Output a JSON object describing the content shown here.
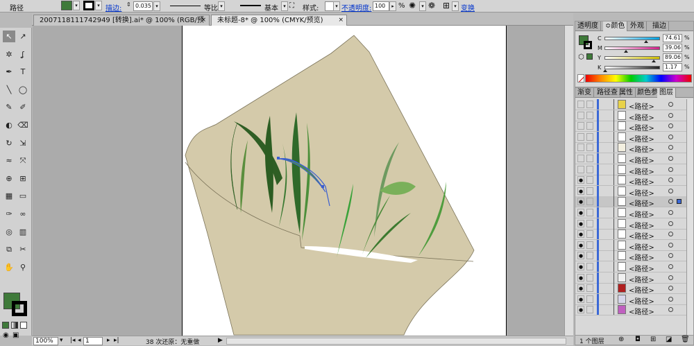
{
  "control_bar": {
    "selection_type": "路径",
    "stroke_label": "描边:",
    "stroke_weight": "0.035",
    "profile_uniform": "等比",
    "brush_basic": "基本",
    "style_label": "样式:",
    "opacity_label": "不透明度:",
    "opacity_value": "100",
    "percent": "%",
    "transform_label": "变换",
    "fill_color": "#3f7a3a",
    "stroke_color": "#000000"
  },
  "document_tabs": [
    {
      "label": "2007118111742949 [转换].ai* @ 100% (RGB/预览)",
      "close": "×"
    },
    {
      "label": "未标题-8* @ 100% (CMYK/预览)",
      "close": "×"
    }
  ],
  "tools": [
    "selection-tool",
    "direct-selection-tool",
    "magic-wand-tool",
    "lasso-tool",
    "pen-tool",
    "type-tool",
    "line-tool",
    "ellipse-tool",
    "paintbrush-tool",
    "pencil-tool",
    "blob-brush-tool",
    "eraser-tool",
    "rotate-tool",
    "scale-tool",
    "warp-tool",
    "free-transform-tool",
    "shape-builder-tool",
    "perspective-grid-tool",
    "mesh-tool",
    "gradient-tool",
    "eyedropper-tool",
    "blend-tool",
    "symbol-sprayer-tool",
    "column-graph-tool",
    "artboard-tool",
    "slice-tool",
    "hand-tool",
    "zoom-tool"
  ],
  "tool_glyphs": [
    "↖",
    "↗",
    "✲",
    "ʆ",
    "✒",
    "T",
    "╲",
    "◯",
    "✎",
    "✐",
    "◐",
    "⌫",
    "↻",
    "⇲",
    "≈",
    "⤧",
    "⊕",
    "⊞",
    "▦",
    "▭",
    "✑",
    "∞",
    "◎",
    "▥",
    "⧉",
    "✂",
    "✋",
    "⚲"
  ],
  "color_panel": {
    "tabs": [
      "透明度",
      "≎颜色",
      "外观",
      "描边"
    ],
    "fill_color": "#3f7a3a",
    "sliders": [
      {
        "key": "C",
        "value": "74.61",
        "color": "#00a0e0",
        "fraction": 0.7461
      },
      {
        "key": "M",
        "value": "39.06",
        "color": "#d0208a",
        "fraction": 0.3906
      },
      {
        "key": "Y",
        "value": "89.06",
        "color": "#d0c000",
        "fraction": 0.8906
      },
      {
        "key": "K",
        "value": "1.17",
        "color": "#222222",
        "fraction": 0.0117
      }
    ],
    "percent": "%"
  },
  "layers_panel": {
    "tabs": [
      "渐变",
      "路径查",
      "属性",
      "颜色参",
      "图层"
    ],
    "rows": [
      {
        "name": "<路径>",
        "visible": false
      },
      {
        "name": "<路径>",
        "visible": false
      },
      {
        "name": "<路径>",
        "visible": false
      },
      {
        "name": "<路径>",
        "visible": false
      },
      {
        "name": "<路径>",
        "visible": false
      },
      {
        "name": "<路径>",
        "visible": false
      },
      {
        "name": "<路径>",
        "visible": false
      },
      {
        "name": "<路径>",
        "visible": true
      },
      {
        "name": "<路径>",
        "visible": true
      },
      {
        "name": "<路径>",
        "visible": true
      },
      {
        "name": "<路径>",
        "visible": true
      },
      {
        "name": "<路径>",
        "visible": true
      },
      {
        "name": "<路径>",
        "visible": true
      },
      {
        "name": "<路径>",
        "visible": true
      },
      {
        "name": "<路径>",
        "visible": true
      },
      {
        "name": "<路径>",
        "visible": true
      },
      {
        "name": "<路径>",
        "visible": true
      },
      {
        "name": "<路径>",
        "visible": true
      },
      {
        "name": "<路径>",
        "visible": true
      },
      {
        "name": "<路径>",
        "visible": true
      }
    ],
    "footer": "1 个图层"
  },
  "status_bar": {
    "zoom": "100%",
    "artboard": "1",
    "undo_text": "38 次还原：无重做"
  }
}
